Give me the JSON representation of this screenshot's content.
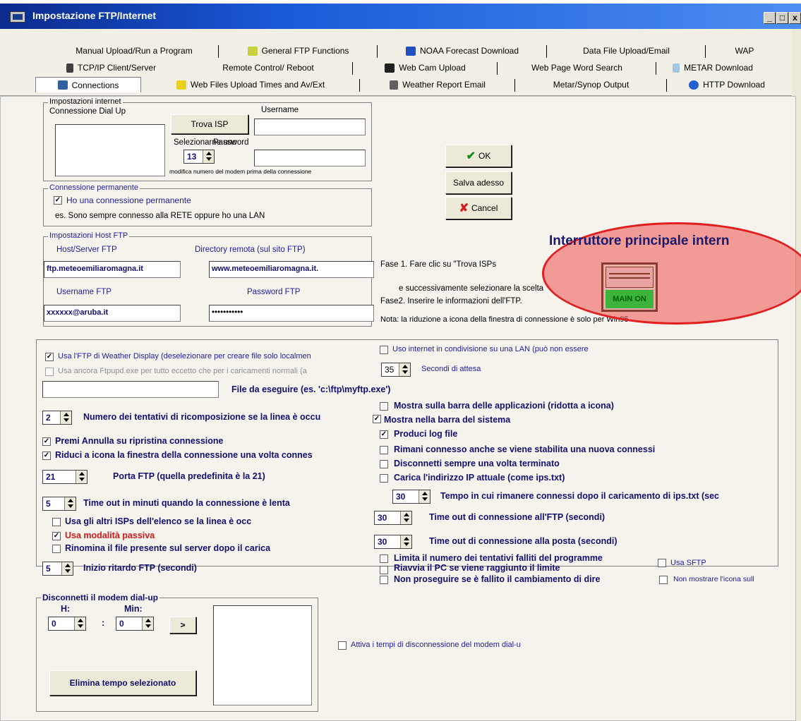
{
  "window": {
    "title": "Impostazione FTP/Internet",
    "controls": [
      "_",
      "□",
      "x"
    ]
  },
  "tabs": {
    "row1": [
      "Manual Upload/Run a Program",
      "General FTP Functions",
      "NOAA Forecast Download",
      "Data File Upload/Email",
      "WAP"
    ],
    "row2": [
      "TCP/IP Client/Server",
      "Remote Control/ Reboot",
      "Web Cam Upload",
      "Web Page Word Search",
      "METAR Download"
    ],
    "row3": [
      "Connections",
      "Web Files Upload Times and Av/Ext",
      "Weather Report Email",
      "Metar/Synop Output",
      "HTTP Download"
    ]
  },
  "internet": {
    "group_title": "Impostazioni internet",
    "dialup_label": "Connessione Dial Up",
    "find_isp": "Trova ISP",
    "select_label": "Selezionarne uno",
    "username_label": "Username",
    "password_label": "Password",
    "modem_value": "13",
    "modem_note": "modifica numero del modem prima della connessione"
  },
  "permanent": {
    "group_title": "Connessione permanente",
    "checkbox_label": "Ho una connessione permanente",
    "checked": true,
    "note": "es. Sono sempre connesso alla RETE oppure ho una LAN"
  },
  "ftp_host": {
    "group_title": "Impostazioni Host FTP",
    "host_label": "Host/Server FTP",
    "host_value": "ftp.meteoemiliaromagna.it",
    "dir_label": "Directory remota (sul sito FTP)",
    "dir_value": "www.meteoemiliaromagna.it.",
    "user_label": "Username FTP",
    "user_value": "xxxxxx@aruba.it",
    "pass_label": "Password FTP",
    "pass_value": "•••••••••••"
  },
  "buttons": {
    "ok": "OK",
    "save": "Salva adesso",
    "cancel": "Cancel"
  },
  "instructions": {
    "line1": "Fase 1. Fare clic su  \"Trova ISPs",
    "line2": "e successivamente selezionare la scelta",
    "line3": "Fase2. Inserire le informazioni dell'FTP.",
    "line4": "Nota: la riduzione a icona della finestra di connessione è solo per Win95"
  },
  "main_switch": {
    "title": "Interruttore principale intern",
    "state": "MAIN ON"
  },
  "options": {
    "use_wd_ftp": "Usa l'FTP di Weather Display (deselezionare per creare file solo localmen",
    "use_ftpupd": "Usa ancora Ftpupd.exe per tutto eccetto che per i caricamenti normali (a",
    "share_lan": "Uso internet in condivisione su una LAN (può non essere",
    "wait_value": "35",
    "wait_label": "Secondi di attesa",
    "file_run_label": "File da eseguire (es. 'c:\\ftp\\myftp.exe')",
    "redial_value": "2",
    "redial_label": "Numero dei tentativi di ricomposizione se la linea è occu",
    "taskbar": "Mostra sulla barra delle applicazioni (ridotta a icona)",
    "systray": "Mostra nella barra del sistema",
    "logfile": "Produci log file",
    "cancel_restore": "Premi Annulla su ripristina connessione",
    "stay_connected": "Rimani connesso anche se viene stabilita una nuova connessi",
    "minimize_conn": "Riduci a icona la finestra della connessione una volta connes",
    "disconnect_always": "Disconnetti sempre una volta terminato",
    "ftp_port_value": "21",
    "ftp_port_label": "Porta FTP (quella predefinita è la 21)",
    "upload_ip": "Carica l'indirizzo IP attuale (come ips.txt)",
    "stay_time_value": "30",
    "stay_time_label": "Tempo in cui rimanere connessi dopo il caricamento di ips.txt (sec",
    "timeout_value": "5",
    "timeout_label": "Time out in minuti quando la connessione è lenta",
    "other_isps": "Usa gli altri ISPs dell'elenco se la linea è occ",
    "passive": "Usa modalità passiva",
    "rename_file": "Rinomina il file presente sul server dopo il carica",
    "ftp_timeout_value": "30",
    "ftp_timeout_label": "Time out di connessione all'FTP (secondi)",
    "mail_timeout_value": "30",
    "mail_timeout_label": "Time out di connessione alla posta (secondi)",
    "delay_value": "5",
    "delay_label": "Inizio ritardo FTP (secondi)",
    "limit_fail": "Limita il numero dei tentativi falliti del programme",
    "restart_pc": "Riavvia il PC se viene raggiunto il limite",
    "no_continue": "Non proseguire se è fallito il cambiamento di dire",
    "use_sftp": "Usa SFTP",
    "no_icon": "Non mostrare l'icona sull"
  },
  "disconnect": {
    "group_title": "Disconnetti il modem dial-up",
    "h_label": "H:",
    "min_label": "Min:",
    "h_value": "0",
    "min_value": "0",
    "colon": ":",
    "arrow_btn": ">",
    "delete_btn": "Elimina tempo selezionato",
    "activate_label": "Attiva i tempi di disconnessione del modem dial-u"
  }
}
